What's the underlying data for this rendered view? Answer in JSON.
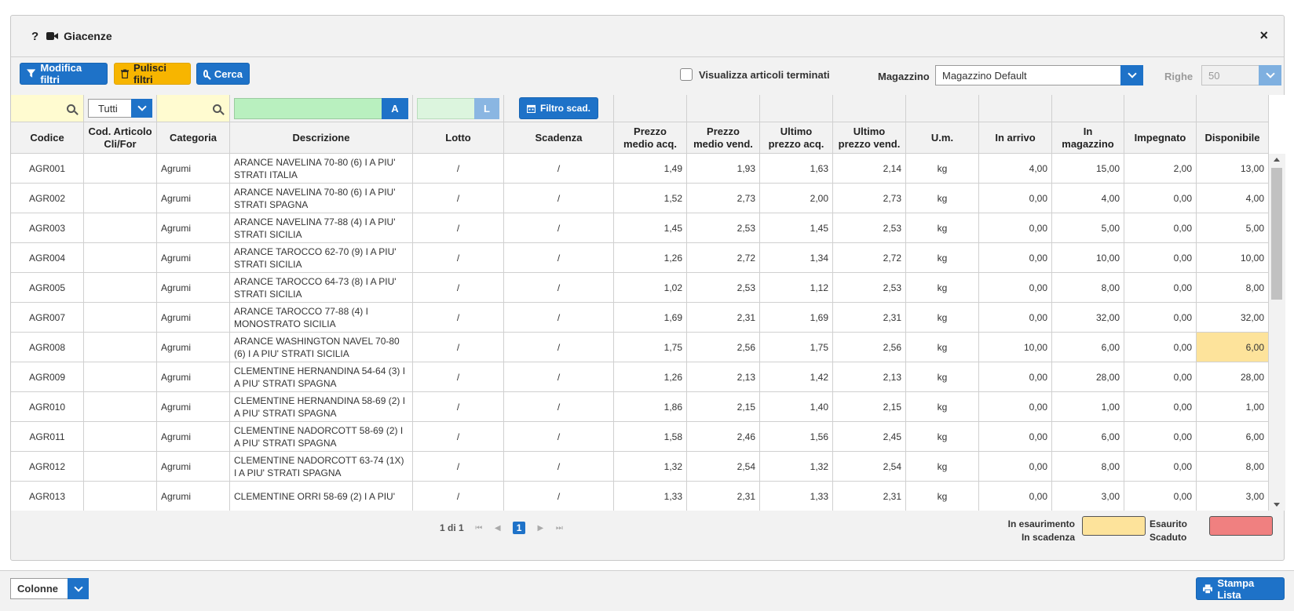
{
  "dialog": {
    "help": "?",
    "title": "Giacenze",
    "close": "×"
  },
  "toolbar": {
    "modifica": "Modifica filtri",
    "pulisci": "Pulisci filtri",
    "cerca": "Cerca",
    "check_label": "Visualizza articoli terminati",
    "magazzino_label": "Magazzino",
    "magazzino_value": "Magazzino Default",
    "righe_label": "Righe",
    "righe_value": "50"
  },
  "filters": {
    "cod_cli_select": "Tutti",
    "desc_letter": "A",
    "lotto_letter": "L",
    "filtro_scad": "Filtro scad."
  },
  "columns": [
    "Codice",
    "Cod. Articolo Cli/For",
    "Categoria",
    "Descrizione",
    "Lotto",
    "Scadenza",
    "Prezzo medio acq.",
    "Prezzo medio vend.",
    "Ultimo prezzo acq.",
    "Ultimo prezzo vend.",
    "U.m.",
    "In arrivo",
    "In magazzino",
    "Impegnato",
    "Disponibile"
  ],
  "rows": [
    {
      "codice": "AGR001",
      "cli": "",
      "categoria": "Agrumi",
      "descrizione": "ARANCE NAVELINA 70-80 (6) I A PIU' STRATI ITALIA",
      "lotto": "/",
      "scadenza": "/",
      "pma": "1,49",
      "pmv": "1,93",
      "upa": "1,63",
      "upv": "2,14",
      "um": "kg",
      "arrivo": "4,00",
      "magazzino": "15,00",
      "impegnato": "2,00",
      "disponibile": "13,00",
      "status": ""
    },
    {
      "codice": "AGR002",
      "cli": "",
      "categoria": "Agrumi",
      "descrizione": "ARANCE NAVELINA 70-80 (6) I A PIU' STRATI SPAGNA",
      "lotto": "/",
      "scadenza": "/",
      "pma": "1,52",
      "pmv": "2,73",
      "upa": "2,00",
      "upv": "2,73",
      "um": "kg",
      "arrivo": "0,00",
      "magazzino": "4,00",
      "impegnato": "0,00",
      "disponibile": "4,00",
      "status": ""
    },
    {
      "codice": "AGR003",
      "cli": "",
      "categoria": "Agrumi",
      "descrizione": "ARANCE NAVELINA 77-88 (4) I A PIU' STRATI SICILIA",
      "lotto": "/",
      "scadenza": "/",
      "pma": "1,45",
      "pmv": "2,53",
      "upa": "1,45",
      "upv": "2,53",
      "um": "kg",
      "arrivo": "0,00",
      "magazzino": "5,00",
      "impegnato": "0,00",
      "disponibile": "5,00",
      "status": ""
    },
    {
      "codice": "AGR004",
      "cli": "",
      "categoria": "Agrumi",
      "descrizione": "ARANCE TAROCCO 62-70 (9) I A PIU' STRATI SICILIA",
      "lotto": "/",
      "scadenza": "/",
      "pma": "1,26",
      "pmv": "2,72",
      "upa": "1,34",
      "upv": "2,72",
      "um": "kg",
      "arrivo": "0,00",
      "magazzino": "10,00",
      "impegnato": "0,00",
      "disponibile": "10,00",
      "status": ""
    },
    {
      "codice": "AGR005",
      "cli": "",
      "categoria": "Agrumi",
      "descrizione": "ARANCE TAROCCO 64-73 (8) I A PIU' STRATI SICILIA",
      "lotto": "/",
      "scadenza": "/",
      "pma": "1,02",
      "pmv": "2,53",
      "upa": "1,12",
      "upv": "2,53",
      "um": "kg",
      "arrivo": "0,00",
      "magazzino": "8,00",
      "impegnato": "0,00",
      "disponibile": "8,00",
      "status": ""
    },
    {
      "codice": "AGR007",
      "cli": "",
      "categoria": "Agrumi",
      "descrizione": "ARANCE TAROCCO 77-88 (4) I MONOSTRATO SICILIA",
      "lotto": "/",
      "scadenza": "/",
      "pma": "1,69",
      "pmv": "2,31",
      "upa": "1,69",
      "upv": "2,31",
      "um": "kg",
      "arrivo": "0,00",
      "magazzino": "32,00",
      "impegnato": "0,00",
      "disponibile": "32,00",
      "status": ""
    },
    {
      "codice": "AGR008",
      "cli": "",
      "categoria": "Agrumi",
      "descrizione": "ARANCE WASHINGTON NAVEL 70-80 (6) I A PIU' STRATI SICILIA",
      "lotto": "/",
      "scadenza": "/",
      "pma": "1,75",
      "pmv": "2,56",
      "upa": "1,75",
      "upv": "2,56",
      "um": "kg",
      "arrivo": "10,00",
      "magazzino": "6,00",
      "impegnato": "0,00",
      "disponibile": "6,00",
      "status": "esaurimento"
    },
    {
      "codice": "AGR009",
      "cli": "",
      "categoria": "Agrumi",
      "descrizione": "CLEMENTINE HERNANDINA 54-64 (3) I A PIU' STRATI SPAGNA",
      "lotto": "/",
      "scadenza": "/",
      "pma": "1,26",
      "pmv": "2,13",
      "upa": "1,42",
      "upv": "2,13",
      "um": "kg",
      "arrivo": "0,00",
      "magazzino": "28,00",
      "impegnato": "0,00",
      "disponibile": "28,00",
      "status": ""
    },
    {
      "codice": "AGR010",
      "cli": "",
      "categoria": "Agrumi",
      "descrizione": "CLEMENTINE HERNANDINA 58-69 (2) I A PIU' STRATI SPAGNA",
      "lotto": "/",
      "scadenza": "/",
      "pma": "1,86",
      "pmv": "2,15",
      "upa": "1,40",
      "upv": "2,15",
      "um": "kg",
      "arrivo": "0,00",
      "magazzino": "1,00",
      "impegnato": "0,00",
      "disponibile": "1,00",
      "status": ""
    },
    {
      "codice": "AGR011",
      "cli": "",
      "categoria": "Agrumi",
      "descrizione": "CLEMENTINE NADORCOTT 58-69 (2) I A PIU' STRATI SPAGNA",
      "lotto": "/",
      "scadenza": "/",
      "pma": "1,58",
      "pmv": "2,46",
      "upa": "1,56",
      "upv": "2,45",
      "um": "kg",
      "arrivo": "0,00",
      "magazzino": "6,00",
      "impegnato": "0,00",
      "disponibile": "6,00",
      "status": ""
    },
    {
      "codice": "AGR012",
      "cli": "",
      "categoria": "Agrumi",
      "descrizione": "CLEMENTINE NADORCOTT 63-74 (1X) I A PIU' STRATI SPAGNA",
      "lotto": "/",
      "scadenza": "/",
      "pma": "1,32",
      "pmv": "2,54",
      "upa": "1,32",
      "upv": "2,54",
      "um": "kg",
      "arrivo": "0,00",
      "magazzino": "8,00",
      "impegnato": "0,00",
      "disponibile": "8,00",
      "status": ""
    },
    {
      "codice": "AGR013",
      "cli": "",
      "categoria": "Agrumi",
      "descrizione": "CLEMENTINE ORRI 58-69 (2) I A PIU'",
      "lotto": "/",
      "scadenza": "/",
      "pma": "1,33",
      "pmv": "2,31",
      "upa": "1,33",
      "upv": "2,31",
      "um": "kg",
      "arrivo": "0,00",
      "magazzino": "3,00",
      "impegnato": "0,00",
      "disponibile": "3,00",
      "status": ""
    }
  ],
  "pager": {
    "info": "1 di 1",
    "current": "1"
  },
  "legend": {
    "esaurimento": "In esaurimento",
    "scadenza": "In scadenza",
    "esaurito": "Esaurito",
    "scaduto": "Scaduto",
    "color_warning": "#fde39b",
    "color_danger": "#f08080"
  },
  "bottom": {
    "colonne": "Colonne",
    "stampa": "Stampa Lista"
  },
  "colors": {
    "accent": "#1e72c8",
    "warning_btn": "#f7b500"
  }
}
